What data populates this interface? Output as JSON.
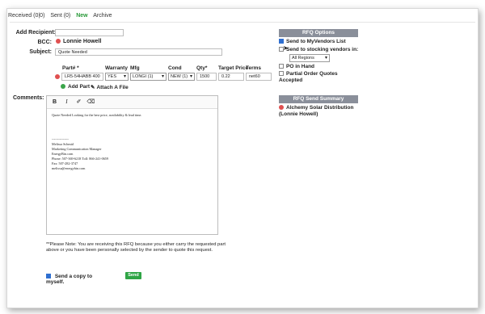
{
  "tabs": [
    {
      "label": "Received (0|0)",
      "active": false
    },
    {
      "label": "Sent (0)",
      "active": false
    },
    {
      "label": "New",
      "active": true
    },
    {
      "label": "Archive",
      "active": false
    }
  ],
  "form": {
    "add_recipient_label": "Add Recipient:",
    "add_recipient_value": "",
    "bcc_label": "BCC:",
    "bcc_name": "Lonnie Howell",
    "subject_label": "Subject:",
    "subject_value": "Quote Needed",
    "comments_label": "Comments:"
  },
  "parts_table": {
    "headers": [
      "Part# *",
      "Warranty",
      "Mfg",
      "Cond",
      "Qty*",
      "Target Price",
      "Terms"
    ],
    "row": {
      "part": "LR5-54HABB 400",
      "warranty": "YES",
      "mfg": "LONGI (1)",
      "cond": "NEW (1)",
      "qty": "1500",
      "target_price": "0.22",
      "terms": "net60"
    },
    "add_part_label": "Add Part",
    "attach_file_label": "Attach A File"
  },
  "editor": {
    "toolbar": [
      "B",
      "I",
      "link",
      "eraser"
    ],
    "lines": [
      "Quote Needed Looking for the best price, availability & lead time.",
      "",
      "",
      "",
      "",
      "---------------",
      "Melissa Schmid",
      "Marketing Communication Manager",
      "EnergyBin.com",
      "Phone: 507-369-6218 Toll: 866-241-0659",
      "Fax: 507-282-3747",
      "melissa@energybin.com"
    ]
  },
  "note": "**Please Note: You are receiving this RFQ because you either carry the requested part above or you have been personally selected by the sender to quote this request.",
  "send_copy_label": "Send a copy to myself.",
  "send_copy_checked": true,
  "send_button": "Send",
  "rfq_options": {
    "title": "RFQ Options",
    "send_myvendors_label": "Send to MyVendors List",
    "send_myvendors_checked": true,
    "send_stocking_label": "Send to stocking vendors in:",
    "send_stocking_checked": false,
    "region": "All Regions",
    "po_in_hand_label": "PO in Hand",
    "partial_order_label": "Partial Order Quotes Accepted"
  },
  "rfq_summary": {
    "title": "RFQ Send Summary",
    "entry": "Alchemy Solar Distribution (Lonnie Howell)"
  },
  "colors": {
    "accent_green": "#2fa545",
    "header_gray": "#8a8f9a",
    "remove_red": "#e05050"
  }
}
